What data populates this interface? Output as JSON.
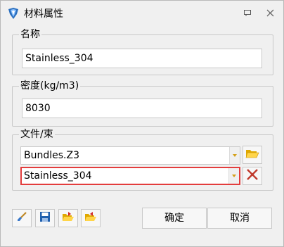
{
  "window": {
    "title": "材料属性"
  },
  "groups": {
    "name": {
      "label": "名称",
      "value": "Stainless_304"
    },
    "density": {
      "label": "密度(kg/m3)",
      "value": "8030"
    },
    "file": {
      "label": "文件/束",
      "bundle_value": "Bundles.Z3",
      "material_value": "Stainless_304"
    }
  },
  "buttons": {
    "ok": "确定",
    "cancel": "取消"
  },
  "icons": {
    "app": "material-app-icon",
    "pin": "pin-icon",
    "close": "close-icon",
    "folder": "folder-open-icon",
    "delete": "delete-x-icon",
    "brush": "paint-brush-icon",
    "save": "save-icon",
    "import": "import-folder-icon",
    "export": "export-folder-icon"
  },
  "colors": {
    "highlight": "#e33d3d",
    "delete": "#c0392b"
  }
}
